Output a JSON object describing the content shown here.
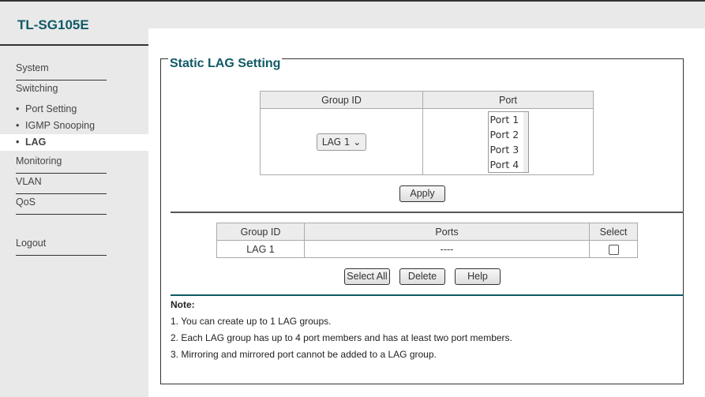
{
  "app": {
    "title": "TL-SG105E"
  },
  "sidebar": {
    "items": [
      {
        "label": "System"
      },
      {
        "label": "Switching"
      },
      {
        "label": "Port Setting"
      },
      {
        "label": "IGMP Snooping"
      },
      {
        "label": "LAG"
      },
      {
        "label": "Monitoring"
      },
      {
        "label": "VLAN"
      },
      {
        "label": "QoS"
      },
      {
        "label": "Logout"
      }
    ]
  },
  "main": {
    "title": "Static LAG Setting",
    "config": {
      "headers": [
        "Group ID",
        "Port"
      ],
      "group_value": "LAG 1",
      "ports": [
        "Port 1",
        "Port 2",
        "Port 3",
        "Port 4"
      ],
      "apply": "Apply"
    },
    "groups": {
      "headers": [
        "Group ID",
        "Ports",
        "Select"
      ],
      "rows": [
        {
          "id": "LAG 1",
          "ports": "----",
          "selected": false
        }
      ]
    },
    "buttons": {
      "select_all": "Select All",
      "delete": "Delete",
      "help": "Help"
    },
    "note": {
      "title": "Note:",
      "lines": [
        "1. You can create up to 1 LAG groups.",
        "2. Each LAG group has up to 4 port members and has at least two port members.",
        "3. Mirroring and mirrored port cannot be added to a LAG group."
      ]
    }
  },
  "colors": {
    "accent": "#105a66"
  }
}
